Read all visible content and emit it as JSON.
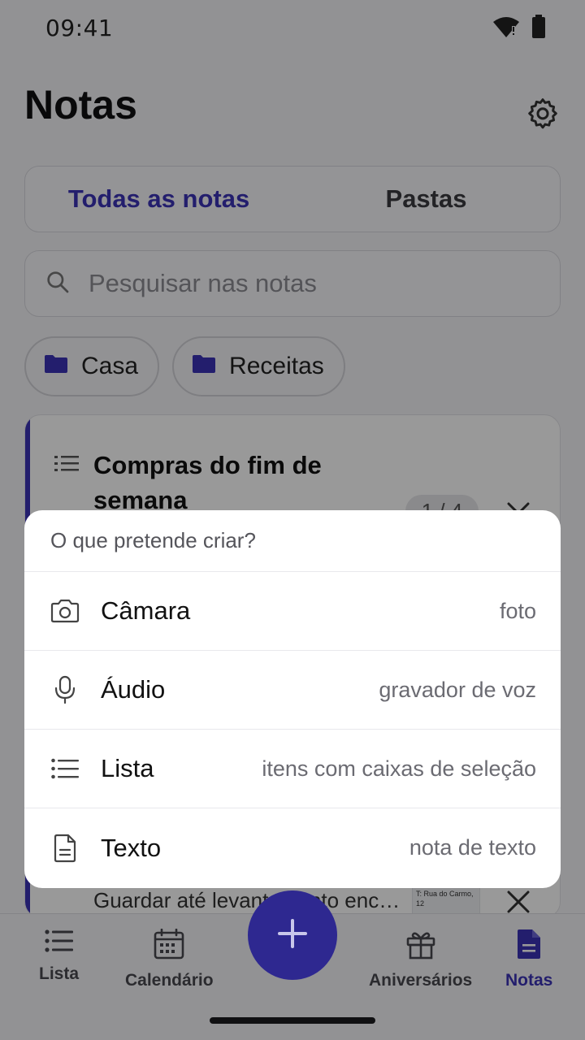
{
  "status_bar": {
    "time": "09:41"
  },
  "header": {
    "title": "Notas"
  },
  "tabs": [
    {
      "label": "Todas as notas",
      "active": true
    },
    {
      "label": "Pastas",
      "active": false
    }
  ],
  "search": {
    "placeholder": "Pesquisar nas notas"
  },
  "folders": [
    {
      "label": "Casa"
    },
    {
      "label": "Receitas"
    }
  ],
  "note_card": {
    "title": "Compras do fim de semana",
    "count": "1 / 4",
    "snippet": "Guardar até levantamento enc…",
    "thumb_text": "T: Rua do Carmo, 12"
  },
  "create_sheet": {
    "prompt": "O que pretende criar?",
    "options": [
      {
        "label": "Câmara",
        "desc": "foto",
        "icon": "camera-icon"
      },
      {
        "label": "Áudio",
        "desc": "gravador de voz",
        "icon": "microphone-icon"
      },
      {
        "label": "Lista",
        "desc": "itens com caixas de seleção",
        "icon": "list-icon"
      },
      {
        "label": "Texto",
        "desc": "nota de texto",
        "icon": "document-icon"
      }
    ]
  },
  "bottom_nav": {
    "items": [
      {
        "label": "Lista",
        "icon": "list-icon",
        "active": false
      },
      {
        "label": "Calendário",
        "icon": "calendar-icon",
        "active": false
      },
      {
        "label": "Aniversários",
        "icon": "gift-icon",
        "active": false
      },
      {
        "label": "Notas",
        "icon": "notes-icon",
        "active": true
      }
    ],
    "fab_icon": "plus-icon"
  },
  "colors": {
    "accent": "#3b33b6",
    "background": "#f4f4f7",
    "surface": "#ffffff"
  }
}
